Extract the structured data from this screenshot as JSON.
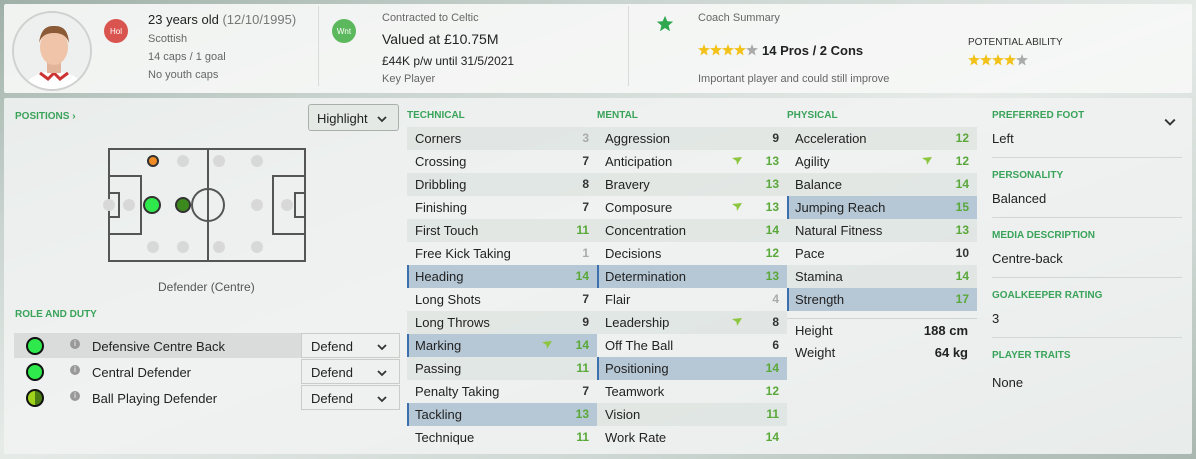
{
  "header": {
    "age_line": "23 years old",
    "dob": "(12/10/1995)",
    "nationality": "Scottish",
    "caps": "14 caps / 1 goal",
    "youth": "No youth caps",
    "nat_badge": "Hol",
    "nat_badge_color": "#d9534f",
    "club_badge": "Wnt",
    "club_badge_color": "#5cb85c",
    "contract": "Contracted to Celtic",
    "value": "Valued at £10.75M",
    "wage": "£44K p/w until 31/5/2021",
    "status": "Key Player",
    "coach_title": "Coach Summary",
    "coach_stars": 4,
    "coach_summary": "14 Pros / 2 Cons",
    "coach_note": "Important player and could still improve",
    "pa_label": "POTENTIAL ABILITY",
    "pa_stars": 4
  },
  "positions": {
    "title": "POSITIONS",
    "highlight": "Highlight",
    "caption": "Defender (Centre)"
  },
  "role_duty": {
    "title": "ROLE AND DUTY",
    "roles": [
      {
        "name": "Defensive Centre Back",
        "duty": "Defend"
      },
      {
        "name": "Central Defender",
        "duty": "Defend"
      },
      {
        "name": "Ball Playing Defender",
        "duty": "Defend"
      }
    ]
  },
  "technical": {
    "title": "TECHNICAL",
    "attrs": [
      {
        "n": "Corners",
        "v": "3"
      },
      {
        "n": "Crossing",
        "v": "7"
      },
      {
        "n": "Dribbling",
        "v": "8"
      },
      {
        "n": "Finishing",
        "v": "7"
      },
      {
        "n": "First Touch",
        "v": "11"
      },
      {
        "n": "Free Kick Taking",
        "v": "1"
      },
      {
        "n": "Heading",
        "v": "14"
      },
      {
        "n": "Long Shots",
        "v": "7"
      },
      {
        "n": "Long Throws",
        "v": "9"
      },
      {
        "n": "Marking",
        "v": "14"
      },
      {
        "n": "Passing",
        "v": "11"
      },
      {
        "n": "Penalty Taking",
        "v": "7"
      },
      {
        "n": "Tackling",
        "v": "13"
      },
      {
        "n": "Technique",
        "v": "11"
      }
    ]
  },
  "mental": {
    "title": "MENTAL",
    "attrs": [
      {
        "n": "Aggression",
        "v": "9"
      },
      {
        "n": "Anticipation",
        "v": "13"
      },
      {
        "n": "Bravery",
        "v": "13"
      },
      {
        "n": "Composure",
        "v": "13"
      },
      {
        "n": "Concentration",
        "v": "14"
      },
      {
        "n": "Decisions",
        "v": "12"
      },
      {
        "n": "Determination",
        "v": "13"
      },
      {
        "n": "Flair",
        "v": "4"
      },
      {
        "n": "Leadership",
        "v": "8"
      },
      {
        "n": "Off The Ball",
        "v": "6"
      },
      {
        "n": "Positioning",
        "v": "14"
      },
      {
        "n": "Teamwork",
        "v": "12"
      },
      {
        "n": "Vision",
        "v": "11"
      },
      {
        "n": "Work Rate",
        "v": "14"
      }
    ]
  },
  "physical": {
    "title": "PHYSICAL",
    "attrs": [
      {
        "n": "Acceleration",
        "v": "12"
      },
      {
        "n": "Agility",
        "v": "12"
      },
      {
        "n": "Balance",
        "v": "14"
      },
      {
        "n": "Jumping Reach",
        "v": "15"
      },
      {
        "n": "Natural Fitness",
        "v": "13"
      },
      {
        "n": "Pace",
        "v": "10"
      },
      {
        "n": "Stamina",
        "v": "14"
      },
      {
        "n": "Strength",
        "v": "17"
      }
    ],
    "height_label": "Height",
    "height": "188 cm",
    "weight_label": "Weight",
    "weight": "64 kg"
  },
  "info": {
    "foot_label": "PREFERRED FOOT",
    "foot": "Left",
    "personality_label": "PERSONALITY",
    "personality": "Balanced",
    "media_label": "MEDIA DESCRIPTION",
    "media": "Centre-back",
    "gk_label": "GOALKEEPER RATING",
    "gk": "3",
    "traits_label": "PLAYER TRAITS",
    "traits": "None"
  },
  "colors": {
    "accent": "#3aa35a",
    "value_green": "#5aa83a",
    "highlight": "#a3b9cc",
    "star": "#f2c21b"
  }
}
